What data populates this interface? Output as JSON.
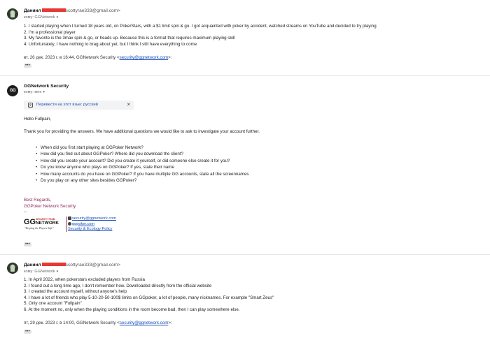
{
  "messages": [
    {
      "sender_name": "Даниил",
      "sender_email": "scottyrae333@gmail.com>",
      "to_line": "кому: GGNetwork",
      "body_lines": [
        "1. I started playing when I turned 18 years old, on PokerStars, with a $1 limit spin & go. I got acquainted with poker by accident, watched streams on YouTube and decided to try playing",
        "2. I'm a professional player",
        "3. My favorite is the 3max spin & go, or heads up. Because this is a format that requires maximum playing skill",
        "4. Unfortunately, I have nothing to brag about yet, but I think I still have everything to come"
      ],
      "footer_prefix": "вт, 26 дек. 2023 г. в 16:44, GGNetwork Security <",
      "footer_link": "security@ggnetwork.com",
      "footer_suffix": ">:",
      "more": "•••"
    },
    {
      "sender_name": "GGNetwork Security",
      "to_line": "кому: мне",
      "translate_label": "Перевести на этот язык: русский",
      "greeting": "Hello Fullpain,",
      "intro": "Thank you for providing the answers. We have additional questions we would like to ask to investigate your account further.",
      "questions": [
        "When did you first start playing at GGPoker Network?",
        "How did you find out about GGPoker? Where did you download the client?",
        "How did you create your account? Did you create it yourself, or did someone else create it for you?",
        "Do you know anyone who plays on GGPoker? If yes, state their name",
        "How many accounts do you have on GGPoker? If you have multiple GG accounts, state all the screennames",
        "Do you play on any other sites besides GGPoker?"
      ],
      "sign_off": "Best Regards,",
      "team": "GGPoker Network Security",
      "dashes": "--",
      "logo_top": "SECURITY TEAM",
      "logo_main": "NETWORK",
      "logo_gg": "GG",
      "logo_tagline": "\"Keeping the Players Safe\"",
      "sig_email": "security@ggnetwork.com",
      "sig_site": "ggpoker.com",
      "sig_policy": "Security & Ecology Policy",
      "more": "•••"
    },
    {
      "sender_name": "Даниил",
      "sender_email": "scottyrae333@gmail.com>",
      "to_line": "кому: GGNetwork",
      "body_lines": [
        "1. In April 2022, when pokerstars excluded players from Russia",
        "2. I found out a long time ago, I don't remember how. Downloaded directly from the official website",
        "3. I created the account myself, without anyone's help",
        "4. I have a lot of friends who play 5-10-20-50-100$ limits on GGpoker, a lot of people, many nicknames. For example \"Smart Zeus\"",
        "5. Only one account \"Fullpain\"",
        "6. At the moment no, only when the playing conditions in the room become bad, then I can play somewhere else."
      ],
      "footer_prefix": "пт, 29 дек. 2023 г. в 14:00, GGNetwork Security <",
      "footer_link": "security@ggnetwork.com",
      "footer_suffix": ">:",
      "more": "•••"
    }
  ],
  "colors": {
    "link": "#1a4fb8",
    "signature": "#8e2b59",
    "redaction": "#e53935"
  }
}
